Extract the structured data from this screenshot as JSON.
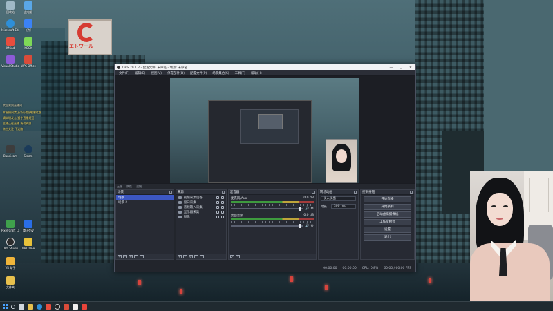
{
  "desktop": {
    "icons": [
      {
        "label": "回收站",
        "color": "#9fb9c7"
      },
      {
        "label": "此电脑",
        "color": "#5aa7e6"
      },
      {
        "label": "Microsoft Edge",
        "color": "#2e8fd8"
      },
      {
        "label": "钉钉",
        "color": "#3b82f6"
      },
      {
        "label": "XMind",
        "color": "#e84d3d"
      },
      {
        "label": "KOOK",
        "color": "#7ed957"
      },
      {
        "label": "Visual Studio",
        "color": "#8c5bd6"
      },
      {
        "label": "WPS Office",
        "color": "#d94c3a"
      },
      {
        "label": "Bandicam",
        "color": "#3d3d3d"
      },
      {
        "label": "Steam",
        "color": "#1b3b5a"
      },
      {
        "label": "Pixel Craft Launcher",
        "color": "#3fa14c"
      },
      {
        "label": "腾讯会议",
        "color": "#2a6ee8"
      },
      {
        "label": "OBS Studio",
        "color": "#2c2c2c"
      },
      {
        "label": "WeGame",
        "color": "#e8c23a"
      },
      {
        "label": "VR 助手",
        "color": "#f0b53a"
      },
      {
        "label": "文件夹",
        "color": "#e7c04d"
      }
    ],
    "sign_text": "エトワール"
  },
  "overlay_text": [
    "欢迎来到直播间",
    "本直播间禁止讨论政治敏感话题",
    "请文明发言 遵守直播规范",
    "主播正在直播 请勿刷屏",
    "点击关注 不迷路"
  ],
  "obs": {
    "window_title": "OBS 29.1.2 - 配置文件: 未命名 - 场景: 未命名",
    "window_controls": {
      "minimize": "—",
      "maximize": "□",
      "close": "✕"
    },
    "menu": [
      "文件(F)",
      "编辑(E)",
      "视图(V)",
      "停靠部件(D)",
      "配置文件(P)",
      "场景集合(S)",
      "工具(T)",
      "帮助(H)"
    ],
    "status_line": [
      "无源",
      "属性",
      "滤镜"
    ],
    "scenes": {
      "title": "场景",
      "items": [
        {
          "label": "场景",
          "selected": true
        },
        {
          "label": "场景 2",
          "selected": false
        }
      ]
    },
    "sources": {
      "title": "来源",
      "items": [
        {
          "label": "视频采集设备"
        },
        {
          "label": "窗口采集"
        },
        {
          "label": "音频输入采集"
        },
        {
          "label": "显示器采集"
        },
        {
          "label": "图像"
        }
      ]
    },
    "mixer": {
      "title": "混音器",
      "tracks": [
        {
          "name": "麦克风/Aux",
          "db": "0.0 dB",
          "level": 0.62
        },
        {
          "name": "桌面音频",
          "db": "0.0 dB",
          "level": 0.7
        }
      ]
    },
    "transitions": {
      "title": "转场动画",
      "type": "淡入淡出",
      "duration_label": "时长",
      "duration": "300 ms"
    },
    "controls": {
      "title": "控制按钮",
      "buttons": [
        "开始直播",
        "开始录制",
        "启动虚拟摄像机",
        "工作室模式",
        "设置",
        "退出"
      ]
    },
    "statusbar": [
      "00:00:00",
      "00:00:00",
      "CPU: 0.8%",
      "60.00 / 60.00 FPS"
    ]
  }
}
